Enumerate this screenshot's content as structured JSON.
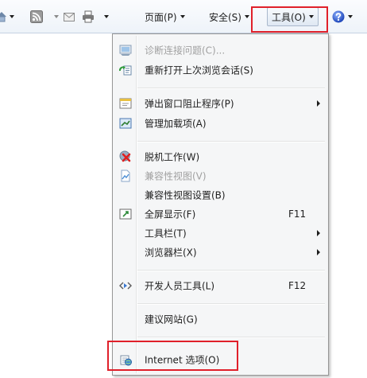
{
  "toolbar": {
    "page_label": "页面(P)",
    "safety_label": "安全(S)",
    "tools_label": "工具(O)"
  },
  "menu": {
    "items": [
      {
        "label": "诊断连接问题(C)...",
        "disabled": true,
        "icon": "diagnose-connection-icon"
      },
      {
        "label": "重新打开上次浏览会话(S)",
        "icon": "reopen-session-icon"
      },
      {
        "label": "弹出窗口阻止程序(P)",
        "submenu": true,
        "icon": "popup-blocker-icon"
      },
      {
        "label": "管理加载项(A)",
        "icon": "manage-addons-icon"
      },
      {
        "label": "脱机工作(W)",
        "icon": "work-offline-icon"
      },
      {
        "label": "兼容性视图(V)",
        "disabled": true,
        "icon": "compatibility-view-icon"
      },
      {
        "label": "兼容性视图设置(B)"
      },
      {
        "label": "全屏显示(F)",
        "shortcut": "F11",
        "icon": "fullscreen-icon"
      },
      {
        "label": "工具栏(T)",
        "submenu": true
      },
      {
        "label": "浏览器栏(X)",
        "submenu": true
      },
      {
        "label": "开发人员工具(L)",
        "shortcut": "F12",
        "icon": "developer-tools-icon"
      },
      {
        "label": "建议网站(G)"
      },
      {
        "label": "Internet 选项(O)",
        "icon": "internet-options-icon"
      }
    ]
  },
  "colors": {
    "highlight_outline": "#e0202a",
    "disabled_text": "#a0a0a0"
  }
}
